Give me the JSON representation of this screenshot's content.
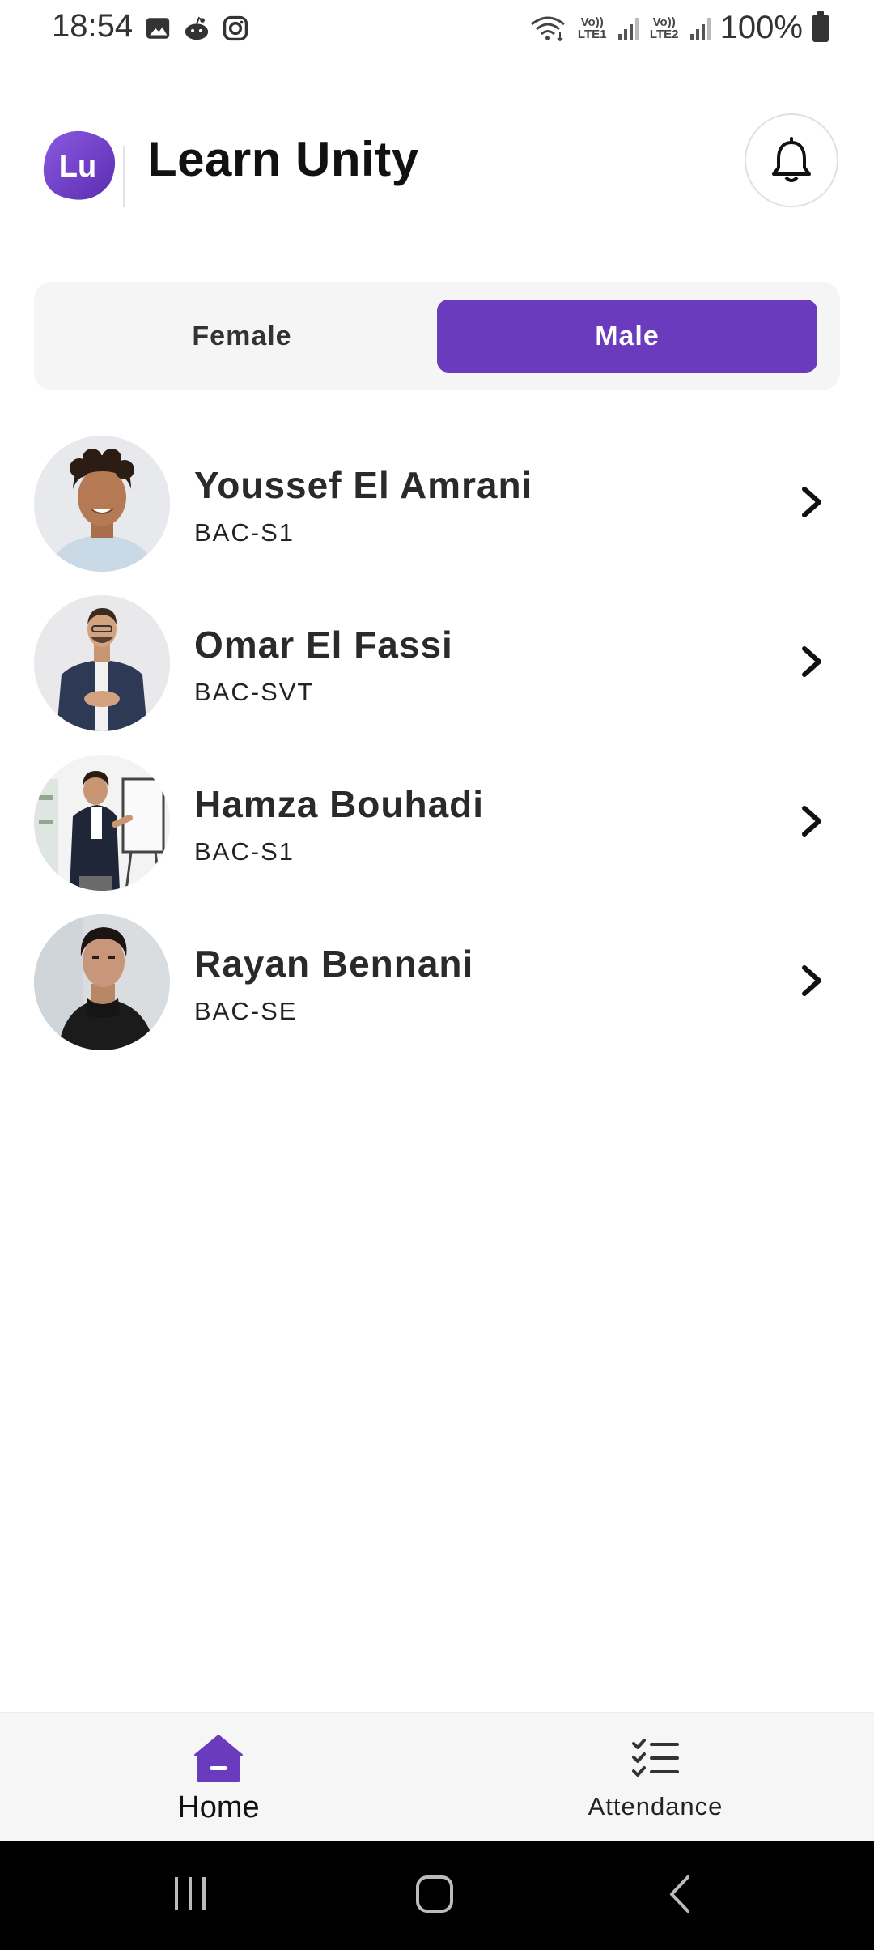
{
  "status_bar": {
    "time": "18:54",
    "battery_text": "100%",
    "sim1_label": "Vo)) LTE1",
    "sim2_label": "Vo)) LTE2",
    "icons": [
      "gallery-icon",
      "reddit-icon",
      "instagram-icon",
      "wifi-icon",
      "signal-icon",
      "battery-icon"
    ]
  },
  "header": {
    "logo_text": "Lu",
    "title": "Learn Unity",
    "notification_icon": "bell-icon"
  },
  "segment": {
    "options": [
      {
        "label": "Female",
        "selected": false
      },
      {
        "label": "Male",
        "selected": true
      }
    ]
  },
  "students": [
    {
      "name": "Youssef El Amrani",
      "class": "BAC-S1"
    },
    {
      "name": "Omar El Fassi",
      "class": "BAC-SVT"
    },
    {
      "name": "Hamza Bouhadi",
      "class": "BAC-S1"
    },
    {
      "name": "Rayan Bennani",
      "class": "BAC-SE"
    }
  ],
  "bottom_nav": {
    "items": [
      {
        "label": "Home",
        "icon": "home-icon",
        "active": true
      },
      {
        "label": "Attendance",
        "icon": "checklist-icon",
        "active": false
      }
    ]
  },
  "colors": {
    "accent": "#6a3bbd",
    "logo_gradient": [
      "#7b4fd6",
      "#5b2bb0"
    ],
    "segment_bg": "#f5f5f6",
    "nav_bg": "#f6f6f7"
  }
}
